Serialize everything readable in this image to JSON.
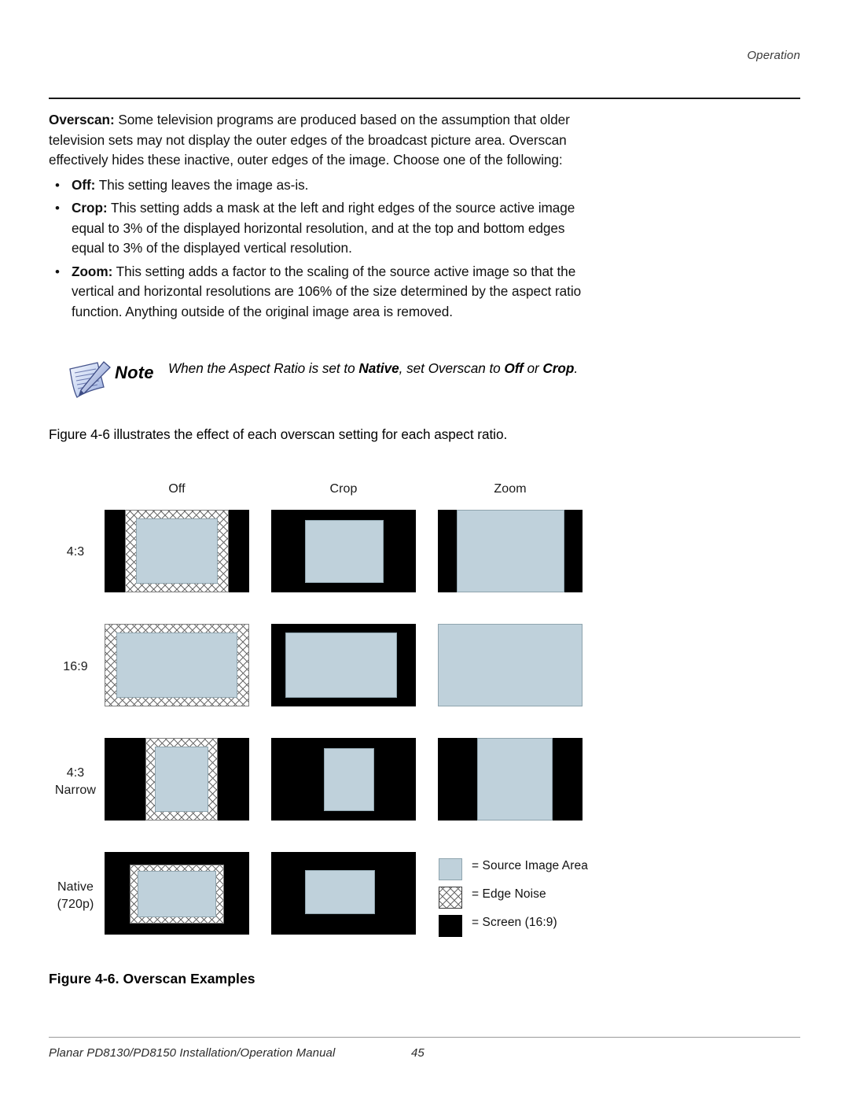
{
  "header": {
    "running_head": "Operation"
  },
  "body": {
    "intro_paragraph_lead": "Overscan:",
    "intro_paragraph_rest": " Some television programs are produced based on the assumption that older television sets may not display the outer edges of the broadcast picture area. Overscan effectively hides these inactive, outer edges of the image. Choose one of the following:",
    "bullets": [
      {
        "marker": "•",
        "term": "Off:",
        "text": " This setting leaves the image as-is."
      },
      {
        "marker": "•",
        "term": "Crop:",
        "text": " This setting adds a mask at the left and right edges of the source active image equal to 3% of the displayed horizontal resolution, and at the top and bottom edges equal to 3% of the displayed vertical resolution."
      },
      {
        "marker": "•",
        "term": "Zoom:",
        "text": " This setting adds a factor to the scaling of the source active image so that the vertical and horizontal resolutions are 106% of the size determined by the aspect ratio function. Anything outside of the original image area is removed."
      }
    ]
  },
  "note": {
    "icon": "note-pad-pen-icon",
    "label": "Note",
    "text_part1": "When the Aspect Ratio is set to ",
    "text_bold1": "Native",
    "text_part2": ", set Overscan to ",
    "text_bold2": "Off",
    "text_part3": " or ",
    "text_bold3": "Crop",
    "text_part4": "."
  },
  "figure_intro": "Figure 4-6 illustrates the effect of each overscan setting for each aspect ratio.",
  "figure": {
    "caption": "Figure 4-6. Overscan Examples",
    "columns": [
      "Off",
      "Crop",
      "Zoom"
    ],
    "rows": [
      {
        "label": "4:3",
        "label_line2": ""
      },
      {
        "label": "16:9",
        "label_line2": ""
      },
      {
        "label": "4:3",
        "label_line2": "Narrow"
      },
      {
        "label": "Native",
        "label_line2": "(720p)"
      }
    ],
    "legend": [
      {
        "swatch": "source",
        "label": "= Source Image Area"
      },
      {
        "swatch": "noise",
        "label": "= Edge Noise"
      },
      {
        "swatch": "screen",
        "label": "= Screen (16:9)"
      }
    ],
    "colors": {
      "source_image_area": "#bfd1db",
      "screen": "#000000",
      "edge_noise_background": "#ffffff",
      "edge_noise_hatch": "#6b6b6b"
    }
  },
  "footer": {
    "manual_title": "Planar PD8130/PD8150 Installation/Operation Manual",
    "page_number": "45"
  }
}
